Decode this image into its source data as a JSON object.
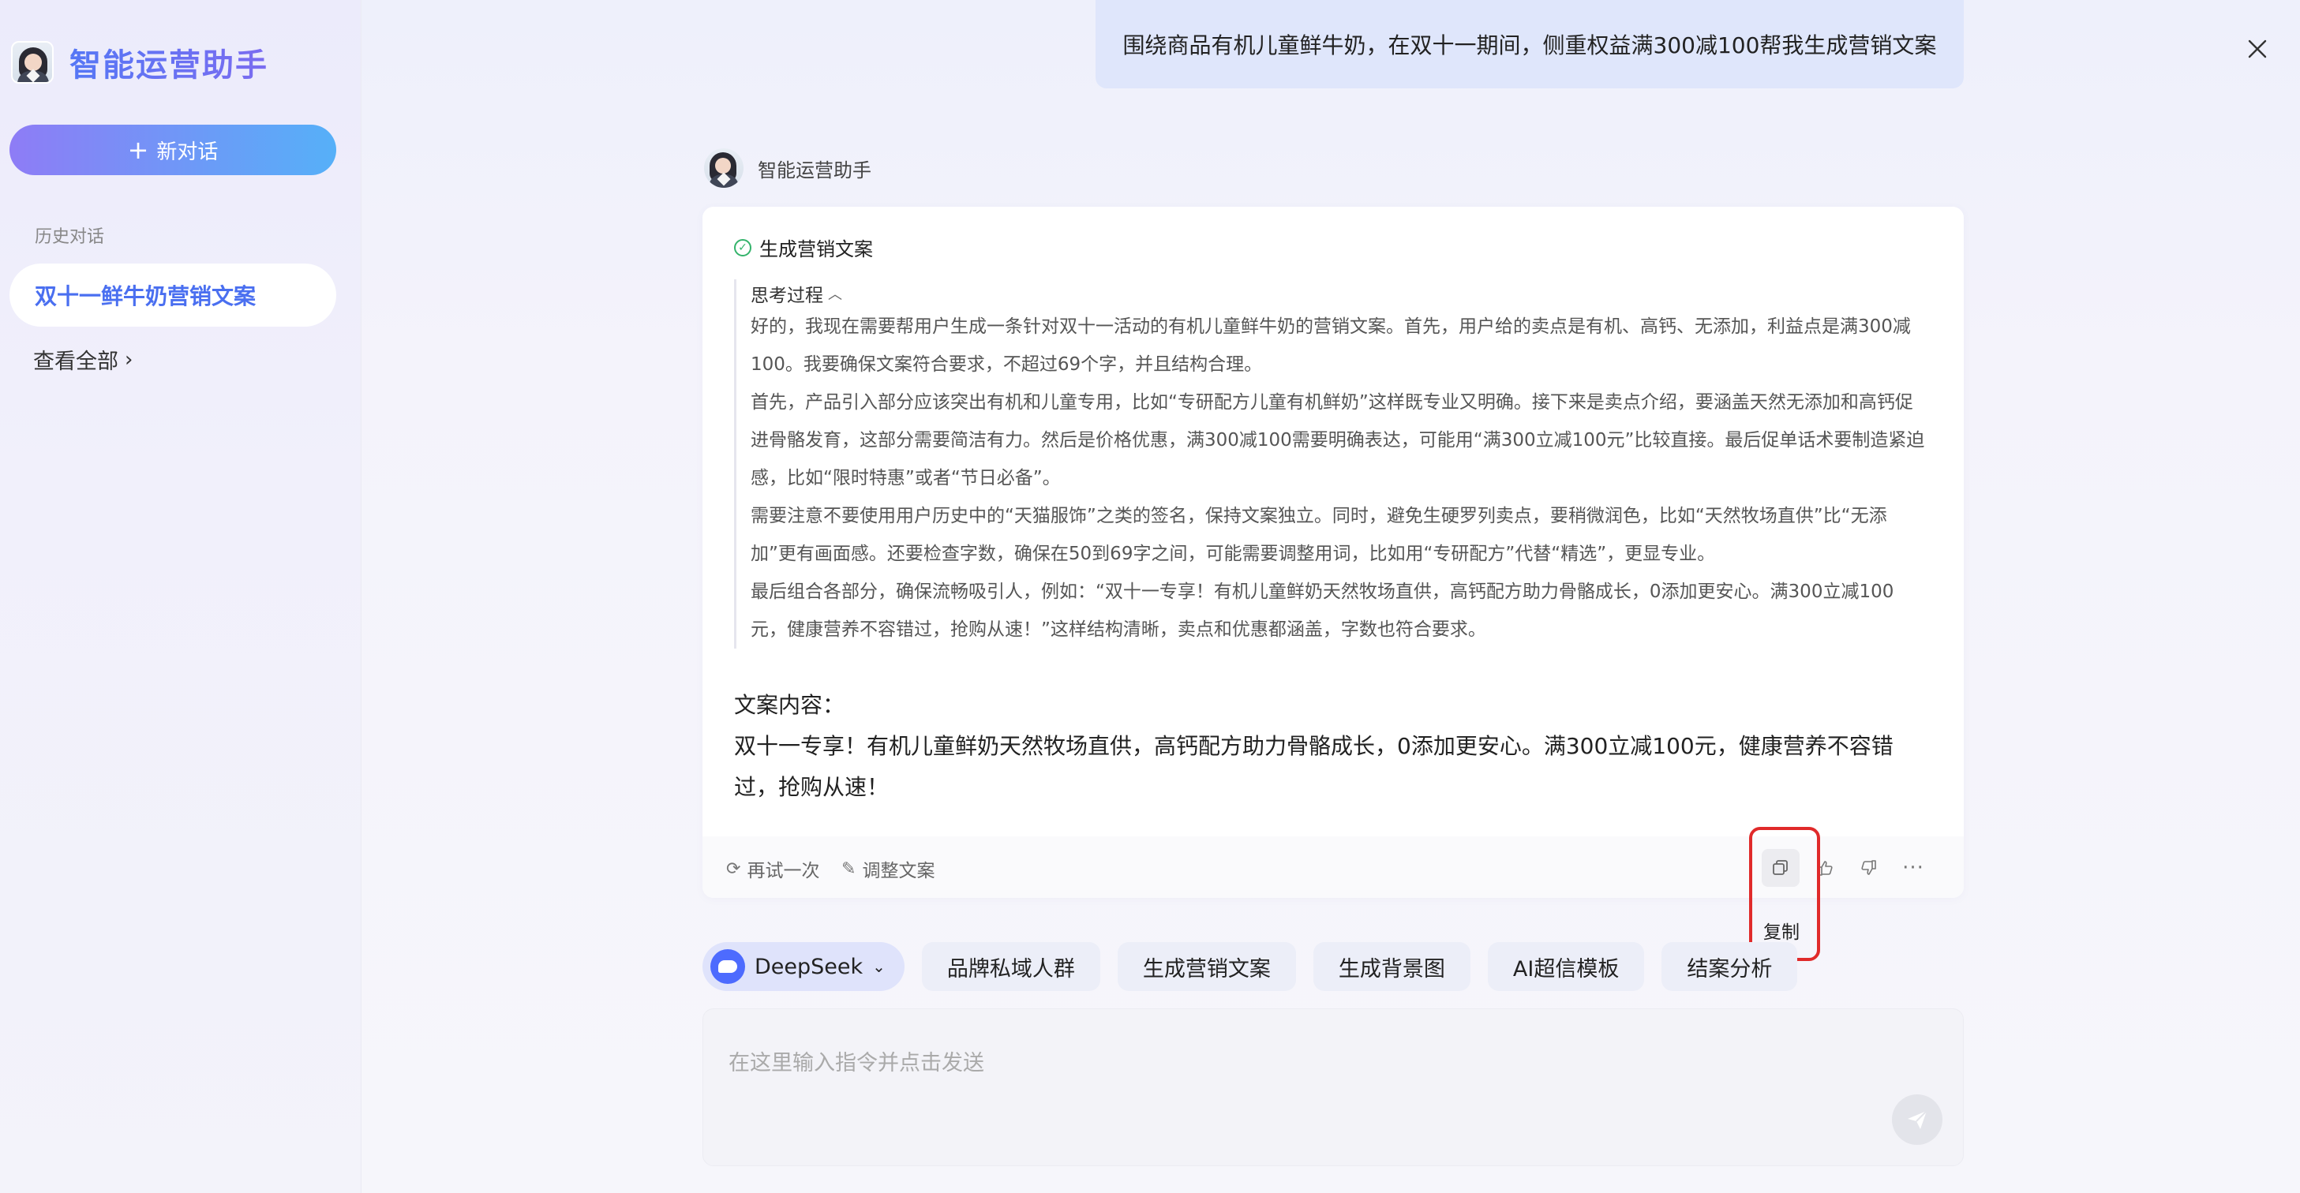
{
  "sidebar": {
    "brand_title": "智能运营助手",
    "new_chat_label": "新对话",
    "history_label": "历史对话",
    "history_items": [
      {
        "label": "双十一鲜牛奶营销文案"
      }
    ],
    "view_all_label": "查看全部"
  },
  "user_message": "围绕商品有机儿童鲜牛奶，在双十一期间，侧重权益满300减100帮我生成营销文案",
  "assistant": {
    "name": "智能运营助手",
    "status": "生成营销文案",
    "think_title": "思考过程",
    "think_paragraphs": [
      "好的，我现在需要帮用户生成一条针对双十一活动的有机儿童鲜牛奶的营销文案。首先，用户给的卖点是有机、高钙、无添加，利益点是满300减100。我要确保文案符合要求，不超过69个字，并且结构合理。",
      "首先，产品引入部分应该突出有机和儿童专用，比如“专研配方儿童有机鲜奶”这样既专业又明确。接下来是卖点介绍，要涵盖天然无添加和高钙促进骨骼发育，这部分需要简洁有力。然后是价格优惠，满300减100需要明确表达，可能用“满300立减100元”比较直接。最后促单话术要制造紧迫感，比如“限时特惠”或者“节日必备”。",
      "需要注意不要使用用户历史中的“天猫服饰”之类的签名，保持文案独立。同时，避免生硬罗列卖点，要稍微润色，比如“天然牧场直供”比“无添加”更有画面感。还要检查字数，确保在50到69字之间，可能需要调整用词，比如用“专研配方”代替“精选”，更显专业。",
      "最后组合各部分，确保流畅吸引人，例如：“双十一专享！有机儿童鲜奶天然牧场直供，高钙配方助力骨骼成长，0添加更安心。满300立减100元，健康营养不容错过，抢购从速！”这样结构清晰，卖点和优惠都涵盖，字数也符合要求。"
    ],
    "copy_label": "文案内容：",
    "copy_body": "双十一专享！有机儿童鲜奶天然牧场直供，高钙配方助力骨骼成长，0添加更安心。满300立减100元，健康营养不容错过，抢购从速！",
    "footer": {
      "retry_label": "再试一次",
      "adjust_label": "调整文案",
      "copy_tooltip": "复制"
    }
  },
  "chips": [
    {
      "label": "DeepSeek"
    },
    {
      "label": "品牌私域人群"
    },
    {
      "label": "生成营销文案"
    },
    {
      "label": "生成背景图"
    },
    {
      "label": "AI超信模板"
    },
    {
      "label": "结案分析"
    }
  ],
  "input": {
    "placeholder": "在这里输入指令并点击发送"
  },
  "colors": {
    "accent": "#4a6ff0",
    "highlight": "#e02a2a",
    "success": "#34b36b"
  }
}
